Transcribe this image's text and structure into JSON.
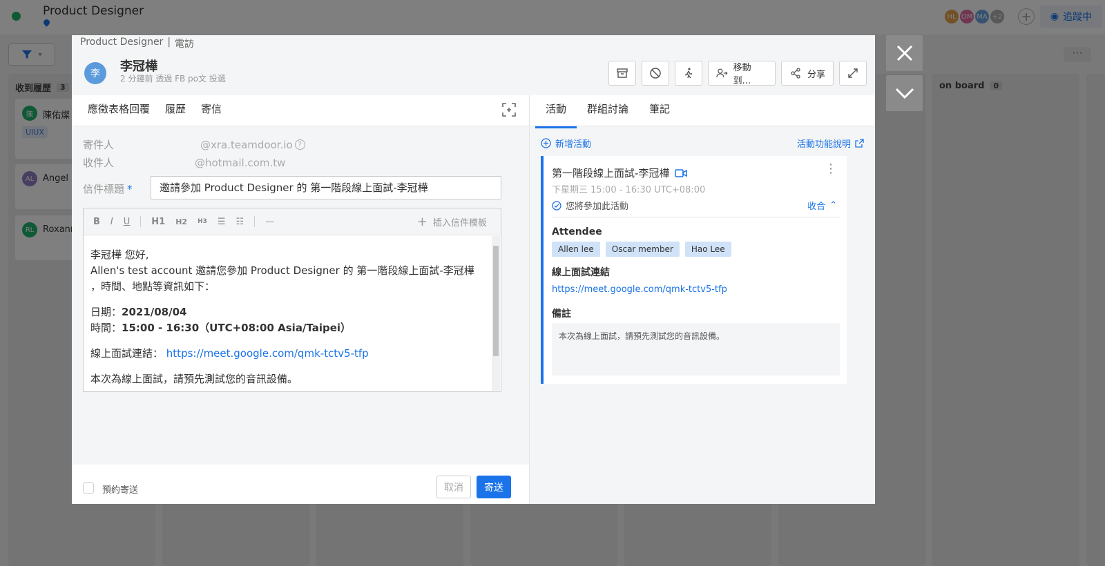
{
  "background": {
    "app_title": "Product Designer",
    "avatars": [
      {
        "initials": "HL",
        "color": "#e8a04a"
      },
      {
        "initials": "OM",
        "color": "#e06aa6"
      },
      {
        "initials": "MA",
        "color": "#6aa6e0"
      },
      {
        "initials": "+2",
        "color": "#b0b0b0"
      }
    ],
    "follow_label": "追蹤中",
    "columns": [
      {
        "title": "收到履歷",
        "count": "3",
        "cards": [
          {
            "initial": "陳",
            "name": "陳佑燦",
            "color": "#21b26c",
            "tag": "UIUX"
          },
          {
            "initial": "AL",
            "name": "Angel",
            "color": "#8e7cc3",
            "tag": ""
          },
          {
            "initial": "RL",
            "name": "Roxanne",
            "color": "#21b26c",
            "tag": ""
          }
        ]
      },
      {
        "title": "on board",
        "count": "0",
        "cards": []
      }
    ]
  },
  "modal": {
    "breadcrumb": {
      "job": "Product Designer",
      "separator": "|",
      "stage": "電訪"
    },
    "candidate": {
      "avatar_initial": "李",
      "name": "李冠樺",
      "subtitle": "2 分鐘前 透過 FB po文 投遞"
    },
    "actions": {
      "move_label": "移動到...",
      "share_label": "分享"
    },
    "left_tabs": [
      "應徵表格回覆",
      "履歷",
      "寄信"
    ],
    "active_left_tab": "寄信",
    "email": {
      "from_label": "寄件人",
      "from_value": "@xra.teamdoor.io",
      "to_label": "收件人",
      "to_value": "@hotmail.com.tw",
      "subject_label": "信件標題",
      "required_mark": "*",
      "subject_value": "邀請參加 Product Designer 的 第一階段線上面試-李冠樺",
      "toolbar": {
        "bold": "B",
        "italic": "I",
        "underline": "U",
        "h1": "H1",
        "h2": "H2",
        "h3": "H3",
        "hr": "—",
        "insert_template": "插入信件模板"
      },
      "body": {
        "greeting": "李冠樺 您好,",
        "line1": "Allen's test account 邀請您參加 Product Designer 的 第一階段線上面試-李冠樺 ，時間、地點等資訊如下：",
        "date_label": "日期：",
        "date_value": "2021/08/04",
        "time_label": "時間：",
        "time_value": "15:00 - 16:30（UTC+08:00 Asia/Taipei）",
        "link_label": "線上面試連結：",
        "link_value": "https://meet.google.com/qmk-tctv5-tfp",
        "note": "本次為線上面試，請預先測試您的音訊設備。"
      },
      "schedule_label": "預約寄送",
      "cancel_label": "取消",
      "send_label": "寄送"
    },
    "right_tabs": [
      "活動",
      "群組討論",
      "筆記"
    ],
    "active_right_tab": "活動",
    "activity": {
      "add_label": "新增活動",
      "help_label": "活動功能說明",
      "title": "第一階段線上面試-李冠樺",
      "time": "下星期三 15:00 - 16:30 UTC+08:00",
      "join_status": "您將參加此活動",
      "collapse_label": "收合",
      "attendee_heading": "Attendee",
      "attendees": [
        "Allen lee",
        "Oscar member",
        "Hao Lee"
      ],
      "link_heading": "線上面試連結",
      "link": "https://meet.google.com/qmk-tctv5-tfp",
      "note_heading": "備註",
      "note": "本次為線上面試，請預先測試您的音訊設備。"
    }
  }
}
